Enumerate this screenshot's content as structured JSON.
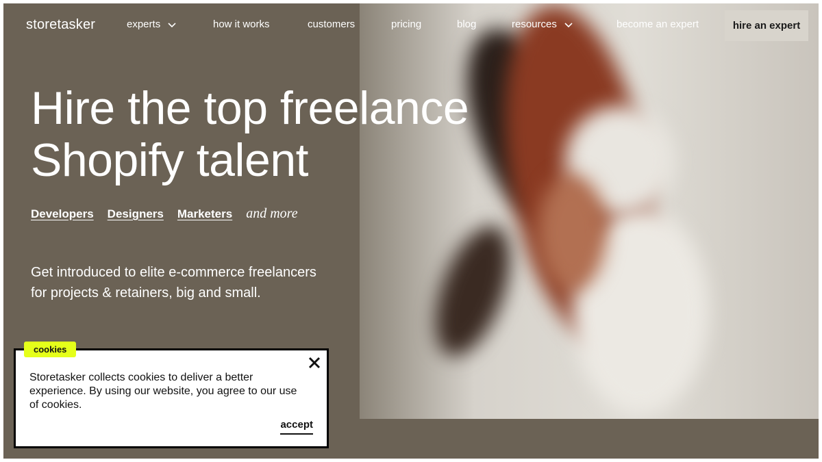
{
  "nav": {
    "logo": "storetasker",
    "items": [
      {
        "label": "experts",
        "has_dropdown": true
      },
      {
        "label": "how it works",
        "has_dropdown": false
      },
      {
        "label": "customers",
        "has_dropdown": false
      },
      {
        "label": "pricing",
        "has_dropdown": false
      },
      {
        "label": "blog",
        "has_dropdown": false
      },
      {
        "label": "resources",
        "has_dropdown": true
      },
      {
        "label": "become an expert",
        "has_dropdown": false
      }
    ],
    "cta_label": "hire an expert"
  },
  "hero": {
    "headline_line1": "Hire the top freelance",
    "headline_line2": "Shopify talent",
    "links": [
      "Developers",
      "Designers",
      "Marketers"
    ],
    "more_text": "and more",
    "intro": "Get introduced to elite e-commerce freelancers for projects & retainers, big and small."
  },
  "cookie_banner": {
    "tag": "cookies",
    "text": "Storetasker collects cookies to deliver a better experience. By using our website, you agree to our use of cookies.",
    "accept_label": "accept",
    "close_icon": "close-icon"
  },
  "colors": {
    "background": "#6b6255",
    "cta_bg": "#d8d4cc",
    "cookie_tag": "#e5ff1a"
  }
}
